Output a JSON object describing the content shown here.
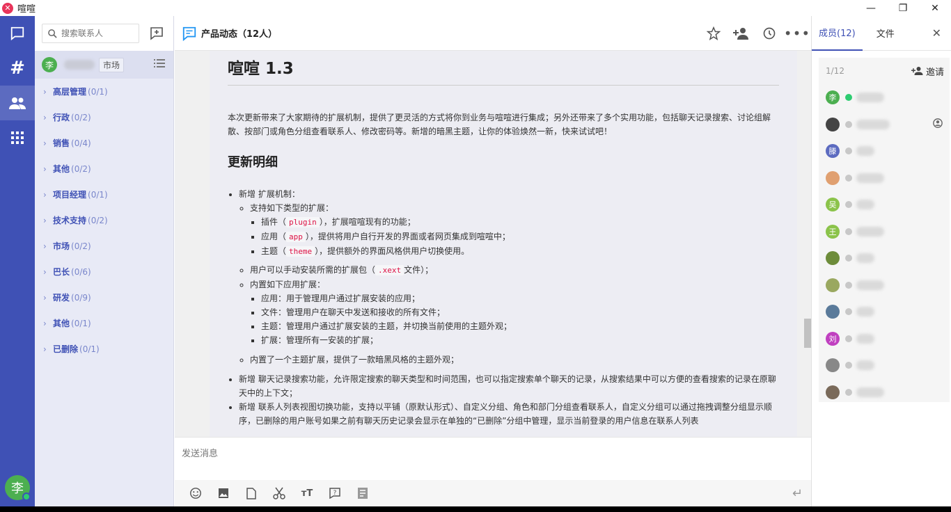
{
  "window": {
    "title": "喧喧",
    "min": "—",
    "max": "❐",
    "close": "✕"
  },
  "contacts": {
    "search_placeholder": "搜索联系人",
    "me": {
      "avatar": "李",
      "dept": "市场"
    },
    "groups": [
      {
        "name": "高层管理",
        "count": "(0/1)"
      },
      {
        "name": "行政",
        "count": "(0/2)"
      },
      {
        "name": "销售",
        "count": "(0/4)"
      },
      {
        "name": "其他",
        "count": "(0/2)"
      },
      {
        "name": "项目经理",
        "count": "(0/1)"
      },
      {
        "name": "技术支持",
        "count": "(0/2)"
      },
      {
        "name": "市场",
        "count": "(0/2)"
      },
      {
        "name": "巴长",
        "count": "(0/6)"
      },
      {
        "name": "研发",
        "count": "(0/9)"
      },
      {
        "name": "其他",
        "count": "(0/1)"
      },
      {
        "name": "已删除",
        "count": "(0/1)"
      }
    ]
  },
  "chat": {
    "title": "产品动态（12人）",
    "doc": {
      "h1": "喧喧 1.3",
      "intro": "本次更新带来了大家期待的扩展机制，提供了更灵活的方式将你到业务与喧喧进行集成；另外还带来了多个实用功能，包括聊天记录搜索、讨论组解散、按部门或角色分组查看联系人、修改密码等。新增的暗黑主题，让你的体验焕然一新，快来试试吧！",
      "h2": "更新明细",
      "ext_title": "新增 扩展机制：",
      "ext_types_title": "支持如下类型的扩展：",
      "t1_pre": "插件（",
      "t1_code": "plugin",
      "t1_post": "），扩展喧喧现有的功能；",
      "t2_pre": "应用（",
      "t2_code": "app",
      "t2_post": "），提供将用户自行开发的界面或者网页集成到喧喧中；",
      "t3_pre": "主题（",
      "t3_code": "theme",
      "t3_post": "），提供额外的界面风格供用户切换使用。",
      "manual_pre": "用户可以手动安装所需的扩展包（",
      "manual_code": ".xext",
      "manual_post": "文件）；",
      "builtin_title": "内置如下应用扩展：",
      "b1": "应用：用于管理用户通过扩展安装的应用；",
      "b2": "文件：管理用户在聊天中发送和接收的所有文件；",
      "b3": "主题：管理用户通过扩展安装的主题，并切换当前使用的主题外观；",
      "b4": "扩展：管理所有一安装的扩展；",
      "theme_builtin": "内置了一个主题扩展，提供了一款暗黑风格的主题外观；",
      "search_item": "新增 聊天记录搜索功能，允许限定搜索的聊天类型和时间范围，也可以指定搜索单个聊天的记录，从搜索结果中可以方便的查看搜索的记录在原聊天中的上下文；",
      "contacts_item": "新增 联系人列表视图切换功能，支持以平铺（原默认形式）、自定义分组、角色和部门分组查看联系人，自定义分组可以通过拖拽调整分组显示顺序，已删除的用户账号如果之前有聊天历史记录会显示在单独的“已删除”分组中管理，显示当前登录的用户信息在联系人列表"
    },
    "compose_placeholder": "发送消息"
  },
  "members": {
    "tab_members": "成员(12)",
    "tab_files": "文件",
    "count": "1/12",
    "invite": "邀请",
    "list": [
      {
        "avatar": "李",
        "color": "#4caf50",
        "online": true,
        "w": 40
      },
      {
        "avatar": "",
        "color": "#444",
        "online": false,
        "w": 48,
        "role": true
      },
      {
        "avatar": "滕",
        "color": "#5c6bc0",
        "online": false,
        "w": 26
      },
      {
        "avatar": "",
        "color": "#e0a070",
        "online": false,
        "w": 40
      },
      {
        "avatar": "吴",
        "color": "#8bc34a",
        "online": false,
        "w": 26
      },
      {
        "avatar": "王",
        "color": "#8bc34a",
        "online": false,
        "w": 40
      },
      {
        "avatar": "",
        "color": "#6d8c3a",
        "online": false,
        "w": 26
      },
      {
        "avatar": "",
        "color": "#9aa860",
        "online": false,
        "w": 40
      },
      {
        "avatar": "",
        "color": "#5a7a9a",
        "online": false,
        "w": 26
      },
      {
        "avatar": "刘",
        "color": "#c040c0",
        "online": false,
        "w": 26
      },
      {
        "avatar": "",
        "color": "#888",
        "online": false,
        "w": 26
      },
      {
        "avatar": "",
        "color": "#7a6a5a",
        "online": false,
        "w": 40
      }
    ]
  }
}
